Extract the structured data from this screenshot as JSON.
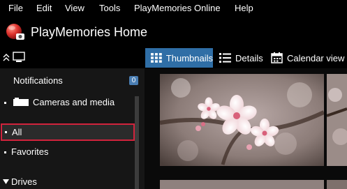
{
  "menu": {
    "items": [
      "File",
      "Edit",
      "View",
      "Tools",
      "PlayMemories Online",
      "Help"
    ]
  },
  "app": {
    "title": "PlayMemories Home"
  },
  "toolbar": {
    "thumbnails_label": "Thumbnails",
    "details_label": "Details",
    "calendar_label": "Calendar view",
    "active_view": "Thumbnails"
  },
  "sidebar": {
    "notifications_label": "Notifications",
    "notifications_count": "0",
    "cameras_label": "Cameras and media",
    "all_label": "All",
    "favorites_label": "Favorites",
    "drives_label": "Drives"
  },
  "colors": {
    "accent": "#2f6ea6",
    "selection_border": "#d2233c",
    "badge": "#4a7eb3",
    "background": "#000000"
  },
  "icons": {
    "logo": "playmemories-logo-icon",
    "collapse": "double-chevron-up-icon",
    "monitor": "monitor-icon",
    "thumbnails": "grid-icon",
    "details": "list-icon",
    "calendar": "calendar-icon",
    "camera": "camera-icon",
    "drives_toggle": "triangle-down-icon"
  }
}
